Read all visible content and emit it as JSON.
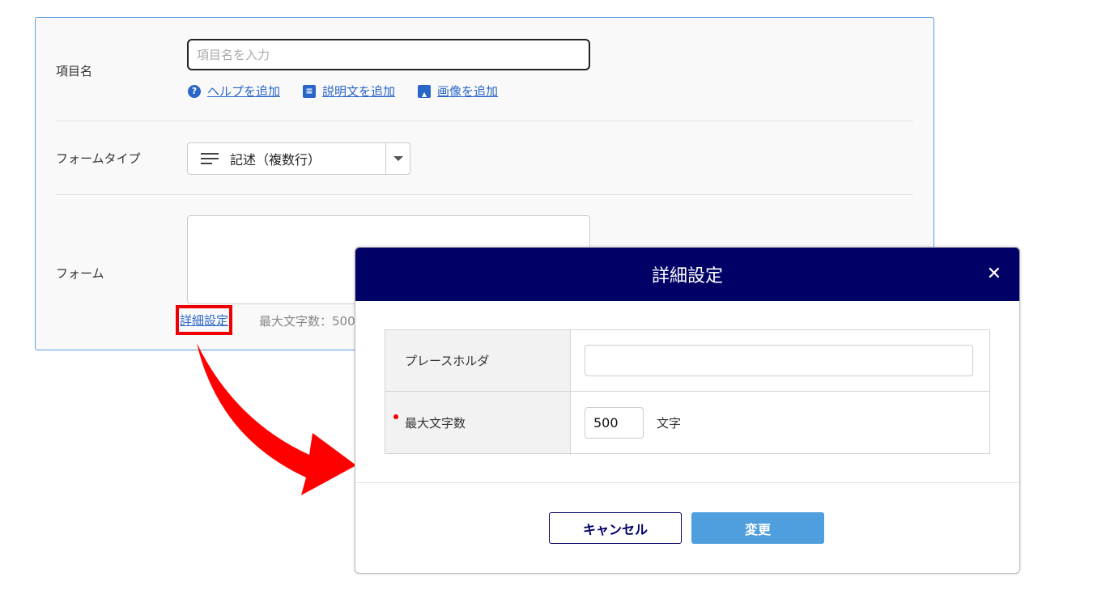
{
  "form": {
    "item_name_label": "項目名",
    "item_name_placeholder": "項目名を入力",
    "links": [
      {
        "icon": "help-icon",
        "glyph": "?",
        "label": "ヘルプを追加"
      },
      {
        "icon": "description-icon",
        "glyph": "≡",
        "label": "説明文を追加"
      },
      {
        "icon": "image-icon",
        "glyph": "▲",
        "label": "画像を追加"
      }
    ],
    "form_type_label": "フォームタイプ",
    "form_type_value": "記述（複数行）",
    "form_label": "フォーム",
    "detail_link": "詳細設定",
    "max_chars_info": "最大文字数：500"
  },
  "modal": {
    "title": "詳細設定",
    "close": "✕",
    "placeholder_label": "プレースホルダ",
    "placeholder_value": "",
    "max_chars_label": "最大文字数",
    "max_chars_value": "500",
    "max_chars_unit": "文字",
    "cancel_label": "キャンセル",
    "ok_label": "変更"
  },
  "colors": {
    "header": "#000066",
    "link": "#2a66c8",
    "highlight": "#ee0000",
    "ok_button": "#4f9fde"
  }
}
